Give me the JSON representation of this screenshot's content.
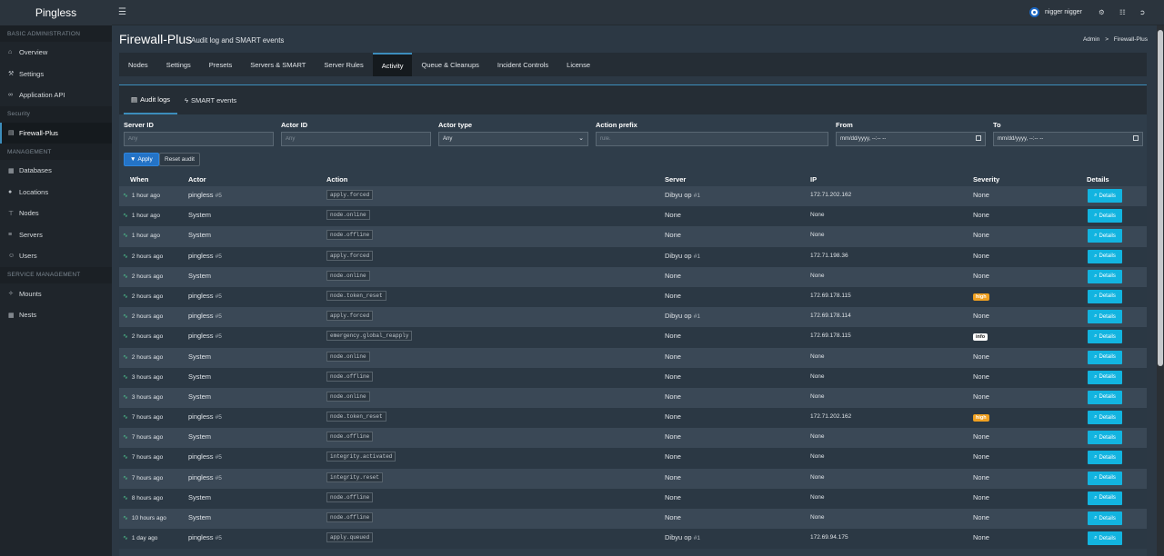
{
  "brand": "Pingless",
  "user": {
    "name": "nigger nigger"
  },
  "sidebar": {
    "sections": [
      {
        "label": "BASIC ADMINISTRATION",
        "items": [
          {
            "label": "Overview",
            "icon": "home-icon"
          },
          {
            "label": "Settings",
            "icon": "wrench-icon"
          },
          {
            "label": "Application API",
            "icon": "link-icon"
          }
        ]
      },
      {
        "label": "Security",
        "items": [
          {
            "label": "Firewall-Plus",
            "icon": "firewall-icon",
            "active": true
          }
        ]
      },
      {
        "label": "MANAGEMENT",
        "items": [
          {
            "label": "Databases",
            "icon": "database-icon"
          },
          {
            "label": "Locations",
            "icon": "globe-icon"
          },
          {
            "label": "Nodes",
            "icon": "sitemap-icon"
          },
          {
            "label": "Servers",
            "icon": "server-icon"
          },
          {
            "label": "Users",
            "icon": "users-icon"
          }
        ]
      },
      {
        "label": "SERVICE MANAGEMENT",
        "items": [
          {
            "label": "Mounts",
            "icon": "magic-icon"
          },
          {
            "label": "Nests",
            "icon": "th-large-icon"
          }
        ]
      }
    ]
  },
  "page": {
    "title": "Firewall-Plus",
    "subtitle": "Audit log and SMART events",
    "breadcrumb": {
      "root": "Admin",
      "sep": ">",
      "current": "Firewall-Plus"
    }
  },
  "tabs": [
    "Nodes",
    "Settings",
    "Presets",
    "Servers & SMART",
    "Server Rules",
    "Activity",
    "Queue & Cleanups",
    "Incident Controls",
    "License"
  ],
  "active_tab": "Activity",
  "subtabs": [
    {
      "label": "Audit logs",
      "icon": "list-icon",
      "active": true
    },
    {
      "label": "SMART events",
      "icon": "bolt-icon",
      "active": false
    }
  ],
  "filters": {
    "server_id": {
      "label": "Server ID",
      "placeholder": "Any"
    },
    "actor_id": {
      "label": "Actor ID",
      "placeholder": "Any"
    },
    "actor_type": {
      "label": "Actor type",
      "value": "Any"
    },
    "action_prefix": {
      "label": "Action prefix",
      "placeholder": "rule."
    },
    "from": {
      "label": "From",
      "placeholder": "mm/dd/yyyy, --:-- --"
    },
    "to": {
      "label": "To",
      "placeholder": "mm/dd/yyyy, --:-- --"
    },
    "apply_label": "Apply",
    "reset_label": "Reset audit"
  },
  "table": {
    "headers": [
      "When",
      "Actor",
      "Action",
      "Server",
      "IP",
      "Severity",
      "Details"
    ],
    "details_label": "Details",
    "rows": [
      {
        "when": "1 hour ago",
        "actor": "pingless",
        "actor_id": "#5",
        "action": "apply.forced",
        "server": "Dibyu op",
        "server_id": "#1",
        "ip": "172.71.202.162",
        "severity": "None"
      },
      {
        "when": "1 hour ago",
        "actor": "System",
        "actor_id": "",
        "action": "node.online",
        "server": "None",
        "server_id": "",
        "ip": "None",
        "severity": "None"
      },
      {
        "when": "1 hour ago",
        "actor": "System",
        "actor_id": "",
        "action": "node.offline",
        "server": "None",
        "server_id": "",
        "ip": "None",
        "severity": "None"
      },
      {
        "when": "2 hours ago",
        "actor": "pingless",
        "actor_id": "#5",
        "action": "apply.forced",
        "server": "Dibyu op",
        "server_id": "#1",
        "ip": "172.71.198.36",
        "severity": "None"
      },
      {
        "when": "2 hours ago",
        "actor": "System",
        "actor_id": "",
        "action": "node.online",
        "server": "None",
        "server_id": "",
        "ip": "None",
        "severity": "None"
      },
      {
        "when": "2 hours ago",
        "actor": "pingless",
        "actor_id": "#5",
        "action": "node.token_reset",
        "server": "None",
        "server_id": "",
        "ip": "172.69.178.115",
        "severity": "high"
      },
      {
        "when": "2 hours ago",
        "actor": "pingless",
        "actor_id": "#5",
        "action": "apply.forced",
        "server": "Dibyu op",
        "server_id": "#1",
        "ip": "172.69.178.114",
        "severity": "None"
      },
      {
        "when": "2 hours ago",
        "actor": "pingless",
        "actor_id": "#5",
        "action": "emergency.global_reapply",
        "server": "None",
        "server_id": "",
        "ip": "172.69.178.115",
        "severity": "info"
      },
      {
        "when": "2 hours ago",
        "actor": "System",
        "actor_id": "",
        "action": "node.online",
        "server": "None",
        "server_id": "",
        "ip": "None",
        "severity": "None"
      },
      {
        "when": "3 hours ago",
        "actor": "System",
        "actor_id": "",
        "action": "node.offline",
        "server": "None",
        "server_id": "",
        "ip": "None",
        "severity": "None"
      },
      {
        "when": "3 hours ago",
        "actor": "System",
        "actor_id": "",
        "action": "node.online",
        "server": "None",
        "server_id": "",
        "ip": "None",
        "severity": "None"
      },
      {
        "when": "7 hours ago",
        "actor": "pingless",
        "actor_id": "#5",
        "action": "node.token_reset",
        "server": "None",
        "server_id": "",
        "ip": "172.71.202.162",
        "severity": "high"
      },
      {
        "when": "7 hours ago",
        "actor": "System",
        "actor_id": "",
        "action": "node.offline",
        "server": "None",
        "server_id": "",
        "ip": "None",
        "severity": "None"
      },
      {
        "when": "7 hours ago",
        "actor": "pingless",
        "actor_id": "#5",
        "action": "integrity.activated",
        "server": "None",
        "server_id": "",
        "ip": "None",
        "severity": "None"
      },
      {
        "when": "7 hours ago",
        "actor": "pingless",
        "actor_id": "#5",
        "action": "integrity.reset",
        "server": "None",
        "server_id": "",
        "ip": "None",
        "severity": "None"
      },
      {
        "when": "8 hours ago",
        "actor": "System",
        "actor_id": "",
        "action": "node.offline",
        "server": "None",
        "server_id": "",
        "ip": "None",
        "severity": "None"
      },
      {
        "when": "10 hours ago",
        "actor": "System",
        "actor_id": "",
        "action": "node.offline",
        "server": "None",
        "server_id": "",
        "ip": "None",
        "severity": "None"
      },
      {
        "when": "1 day ago",
        "actor": "pingless",
        "actor_id": "#5",
        "action": "apply.queued",
        "server": "Dibyu op",
        "server_id": "#1",
        "ip": "172.69.94.175",
        "severity": "None"
      }
    ]
  },
  "colors": {
    "accent": "#3c8dbc",
    "details_button": "#12b4e0",
    "apply_button": "#2473c6",
    "severity_high": "#f0a020"
  }
}
